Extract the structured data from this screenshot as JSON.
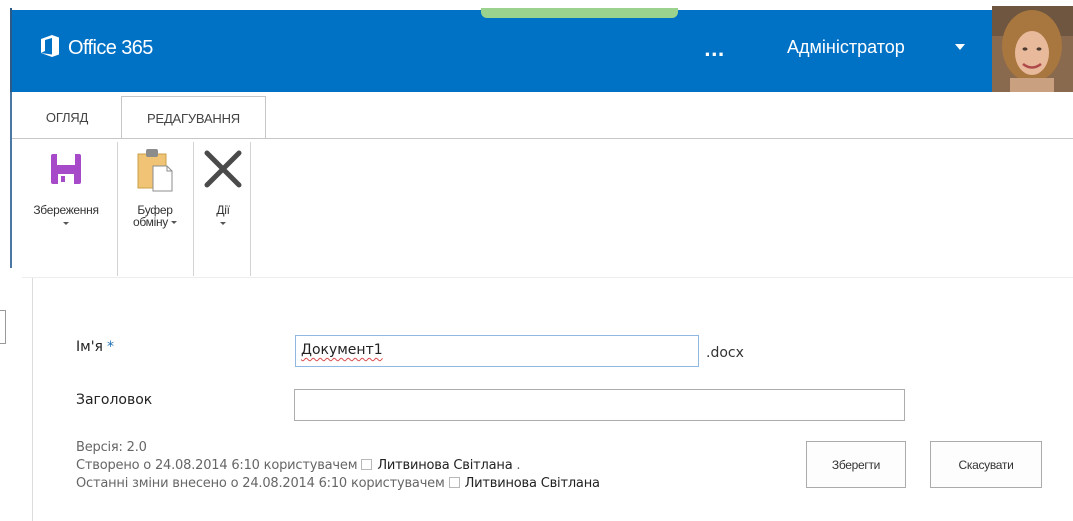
{
  "suite_bar": {
    "brand": "Office 365",
    "more_label": "...",
    "user_name": "Адміністратор",
    "colors": {
      "bar": "#0072c6",
      "accent_green": "#9bd28e"
    }
  },
  "ribbon": {
    "tabs": [
      {
        "label": "ОГЛЯД",
        "selected": false
      },
      {
        "label": "РЕДАГУВАННЯ",
        "selected": true
      }
    ],
    "commands": [
      {
        "label": "Збереження",
        "icon": "save-icon"
      },
      {
        "label_line1": "Буфер",
        "label_line2": "обміну",
        "icon": "clipboard-icon"
      },
      {
        "label": "Дії",
        "icon": "close-icon"
      }
    ]
  },
  "form": {
    "name_label": "Ім'я",
    "required_mark": "*",
    "name_value": "Документ1",
    "extension": ".docx",
    "title_label": "Заголовок",
    "title_value": "",
    "version_line": "Версія: 2.0",
    "created_prefix": "Створено о 24.08.2014 6:10  користувачем",
    "created_user": "Литвинова Світлана",
    "created_suffix": " .",
    "modified_prefix": "Останні зміни внесено о 24.08.2014 6:10  користувачем",
    "modified_user": "Литвинова Світлана",
    "save_button": "Зберегти",
    "cancel_button": "Скасувати"
  }
}
